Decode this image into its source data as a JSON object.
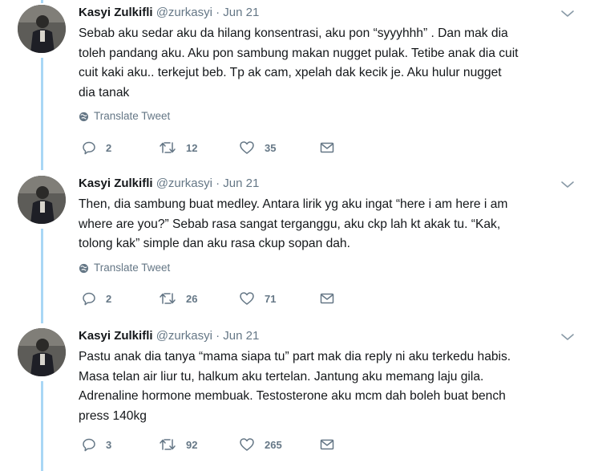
{
  "tweets": [
    {
      "name": "Kasyi Zulkifli",
      "handle": "@zurkasyi",
      "separator": "·",
      "date": "Jun 21",
      "lines": [
        "Sebab aku sedar aku da hilang konsentrasi, aku pon “syyyhhh” . Dan mak dia",
        "toleh pandang aku. Aku pon sambung makan nugget pulak. Tetibe anak dia cuit",
        "cuit kaki aku.. terkejut beb. Tp ak cam, xpelah dak kecik je. Aku hulur nugget",
        "dia tanak"
      ],
      "translate": "Translate Tweet",
      "replies": "2",
      "retweets": "12",
      "likes": "35"
    },
    {
      "name": "Kasyi Zulkifli",
      "handle": "@zurkasyi",
      "separator": "·",
      "date": "Jun 21",
      "lines": [
        "Then, dia sambung buat medley. Antara lirik yg aku ingat “here i am here i am",
        "where are you?” Sebab rasa sangat terganggu, aku ckp lah kt akak tu. “Kak,",
        "tolong kak” simple dan aku rasa ckup sopan dah."
      ],
      "translate": "Translate Tweet",
      "replies": "2",
      "retweets": "26",
      "likes": "71"
    },
    {
      "name": "Kasyi Zulkifli",
      "handle": "@zurkasyi",
      "separator": "·",
      "date": "Jun 21",
      "lines": [
        "Pastu anak dia tanya “mama siapa tu” part mak dia reply ni aku terkedu habis.",
        "Masa telan air liur tu, halkum aku tertelan. Jantung aku memang laju gila.",
        "Adrenaline hormone membuak. Testosterone aku mcm dah boleh buat bench",
        "press 140kg"
      ],
      "replies": "3",
      "retweets": "92",
      "likes": "265"
    }
  ],
  "icons": {
    "reply": "reply-icon",
    "retweet": "retweet-icon",
    "like": "like-icon",
    "message": "message-icon",
    "more": "chevron-down-icon",
    "translate": "globe-icon"
  },
  "colors": {
    "thread_line": "#a9d7f5",
    "secondary_text": "#657786",
    "primary_text": "#14171a"
  }
}
